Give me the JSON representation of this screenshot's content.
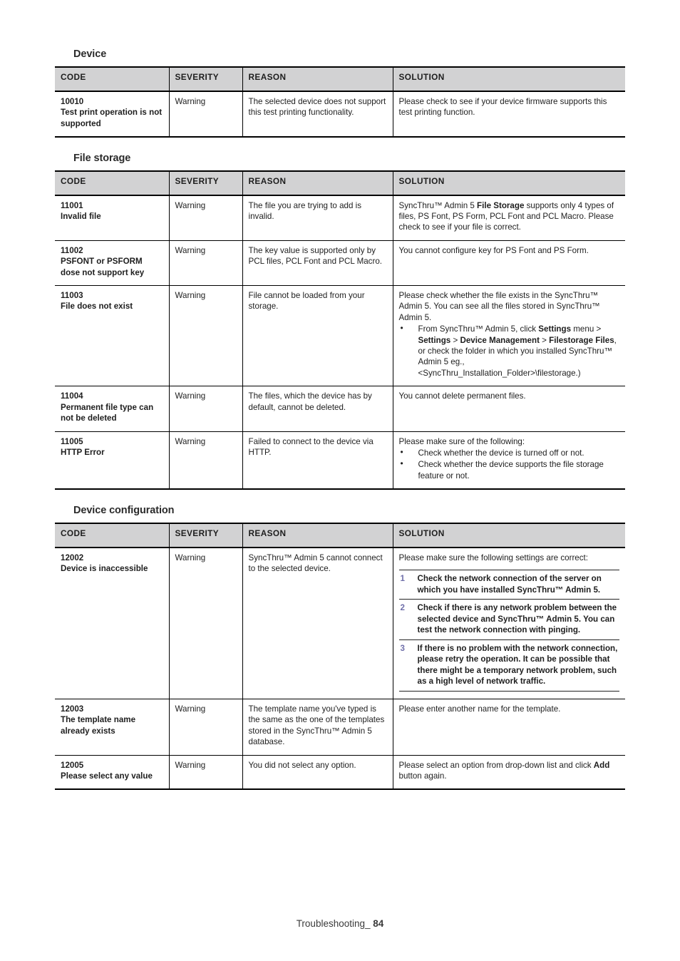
{
  "page": {
    "footer_label": "Troubleshooting_",
    "footer_page": "84"
  },
  "columns": {
    "code": "CODE",
    "severity": "SEVERITY",
    "reason": "REASON",
    "solution": "SOLUTION"
  },
  "sections": [
    {
      "heading": "Device",
      "rows": [
        {
          "code": "10010",
          "code_name": "Test print operation is not supported",
          "severity": "Warning",
          "reason": "The selected device does not support this test printing functionality.",
          "solution_intro": "Please check to see if your device firmware supports this test printing function."
        }
      ]
    },
    {
      "heading": "File storage",
      "rows": [
        {
          "code": "11001",
          "code_name": "Invalid file",
          "severity": "Warning",
          "reason": "The file you are trying to add is invalid.",
          "solution_intro": "SyncThru™ Admin 5 File Storage supports only 4 types of files, PS Font, PS Form, PCL Font and PCL Macro. Please check to see if your file is correct.",
          "solution_bold_parts": [
            "File Storage"
          ]
        },
        {
          "code": "11002",
          "code_name": "PSFONT or PSFORM dose not support key",
          "severity": "Warning",
          "reason": "The key value is supported only by PCL files, PCL Font and PCL Macro.",
          "solution_intro": "You cannot configure key for PS Font and PS Form."
        },
        {
          "code": "11003",
          "code_name": "File does not exist",
          "severity": "Warning",
          "reason": "File cannot be loaded from your storage.",
          "solution_intro": "Please check whether the file exists in the SyncThru™ Admin 5. You can see all the files stored in SyncThru™ Admin 5.",
          "solution_bullets": [
            "From SyncThru™ Admin 5, click Settings menu > Settings > Device Management > Filestorage Files, or check the folder in which you installed SyncThru™ Admin 5 eg.,<SyncThru_Installation_Folder>\\filestorage.)"
          ],
          "solution_bold_parts": [
            "Settings",
            "Settings",
            "Device Management",
            "Filestorage Files"
          ]
        },
        {
          "code": "11004",
          "code_name": "Permanent file type can not be deleted",
          "severity": "Warning",
          "reason": "The files, which the device has by default, cannot be deleted.",
          "solution_intro": "You cannot delete permanent files."
        },
        {
          "code": "11005",
          "code_name": "HTTP Error",
          "severity": "Warning",
          "reason": "Failed to connect to the device via HTTP.",
          "solution_intro": "Please make sure of the following:",
          "solution_bullets": [
            "Check whether the device is turned off or not.",
            "Check whether the device supports the file storage feature or not."
          ]
        }
      ]
    },
    {
      "heading": "Device configuration",
      "rows": [
        {
          "code": "12002",
          "code_name": "Device is inaccessible",
          "severity": "Warning",
          "reason": "SyncThru™ Admin 5 cannot connect to the selected device.",
          "solution_intro": "Please make sure the following settings are correct:",
          "solution_steps": [
            {
              "num": "1",
              "text": "Check the network connection of the server on which you have installed SyncThru™ Admin 5."
            },
            {
              "num": "2",
              "text": "Check if there is any network problem between the selected device and SyncThru™ Admin 5. You can test the network connection with pinging."
            },
            {
              "num": "3",
              "text": "If there is no problem with the network connection, please retry the operation. It can be possible that there might be a temporary network problem, such as a high level of network traffic."
            }
          ]
        },
        {
          "code": "12003",
          "code_name": "The template name already exists",
          "severity": "Warning",
          "reason": "The template name you've typed is the same as the one of the templates stored in the SyncThru™ Admin 5 database.",
          "solution_intro": "Please enter another name for the template."
        },
        {
          "code": "12005",
          "code_name": "Please select any value",
          "severity": "Warning",
          "reason": "You did not select any option.",
          "solution_intro": "Please select an option from drop-down list and click Add button again.",
          "solution_bold_parts": [
            "Add"
          ]
        }
      ]
    }
  ]
}
